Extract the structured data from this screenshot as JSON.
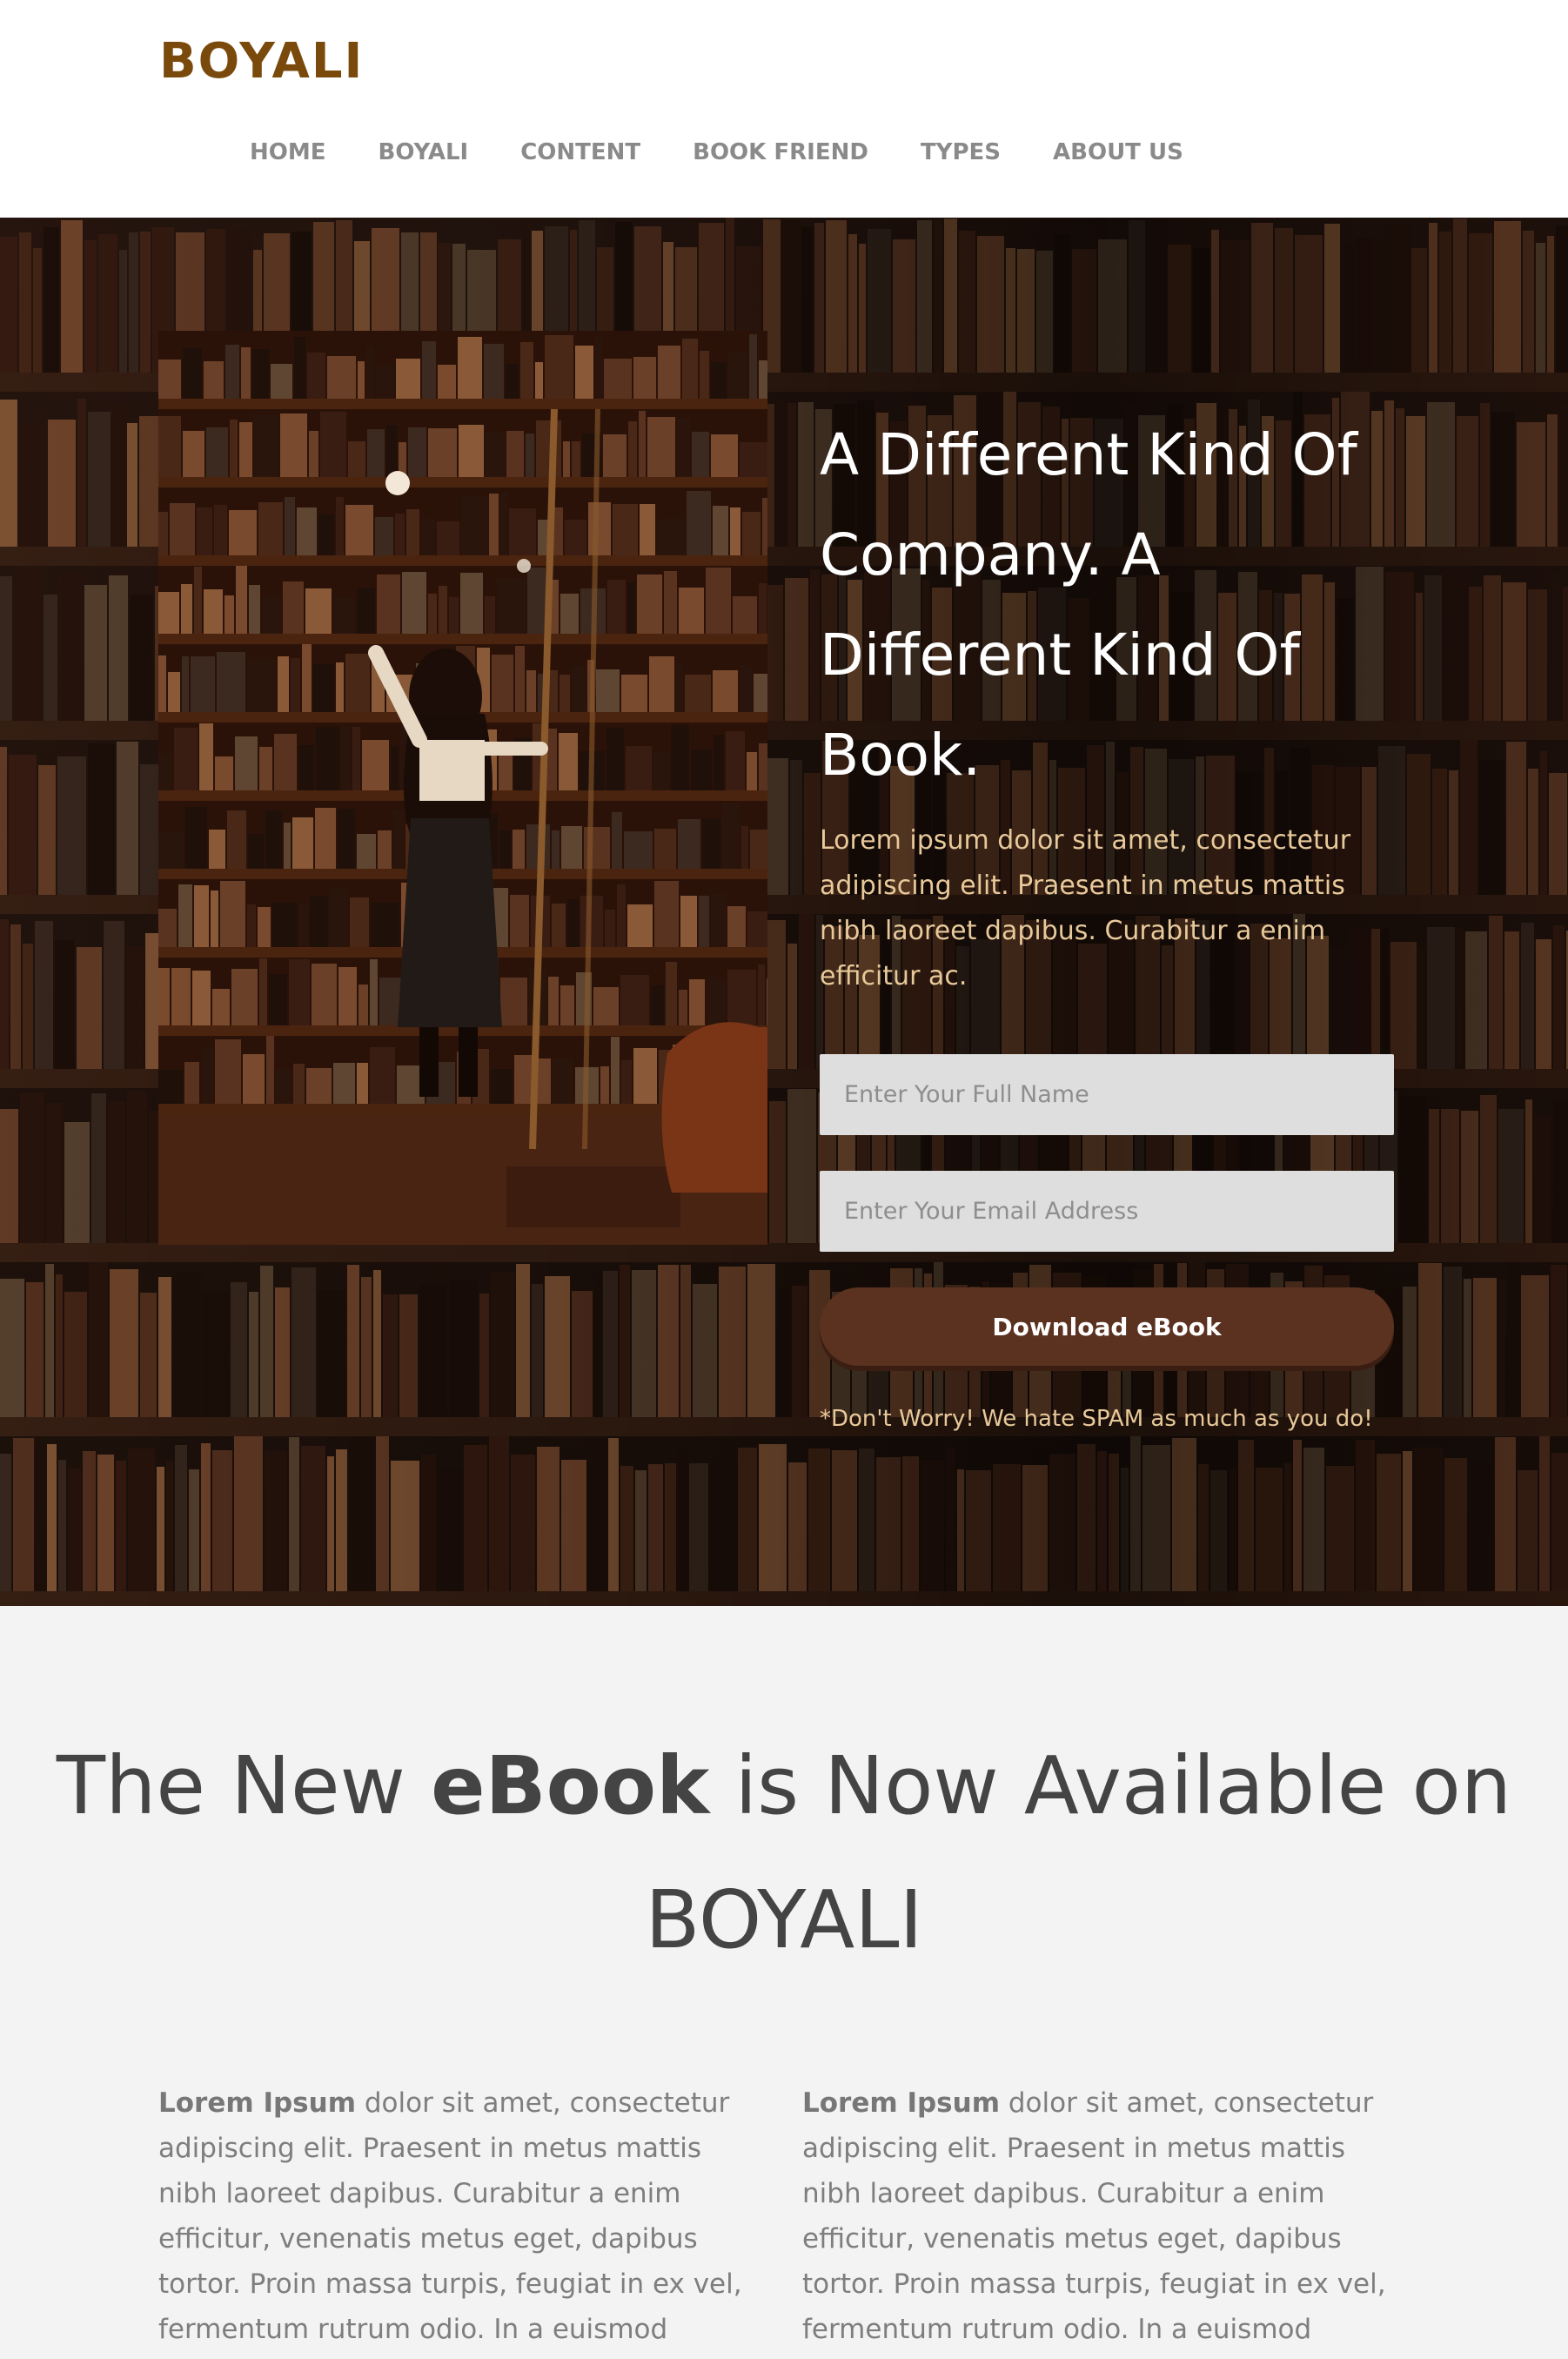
{
  "brand": {
    "logo": "BOYALI",
    "logo_color": "#7a4a0c"
  },
  "nav": {
    "items": [
      {
        "label": "HOME"
      },
      {
        "label": "BOYALI"
      },
      {
        "label": "CONTENT"
      },
      {
        "label": "BOOK FRIEND"
      },
      {
        "label": "TYPES"
      },
      {
        "label": "ABOUT US"
      }
    ]
  },
  "hero": {
    "title": "A Different Kind Of Company. A Different Kind Of Book.",
    "description": "Lorem ipsum dolor sit amet, consectetur adipiscing elit. Praesent in metus mattis nibh laoreet dapibus. Curabitur a enim efficitur ac.",
    "name_placeholder": "Enter Your Full Name",
    "email_placeholder": "Enter Your Email Address",
    "button_label": "Download eBook",
    "note": "*Don't Worry! We hate SPAM as much as you do!",
    "accent_color": "#5b3220",
    "text_accent_color": "#e8c99a"
  },
  "section": {
    "title_before": "The New ",
    "title_bold": "eBook",
    "title_after": " is Now Available on BOYALI"
  },
  "columns": [
    {
      "lead": "Lorem Ipsum",
      "text": " dolor sit amet, consectetur adipiscing elit. Praesent in metus mattis nibh laoreet dapibus. Curabitur a enim efficitur, venenatis metus eget, dapibus tortor. Proin massa turpis, feugiat in ex vel, fermentum rutrum odio. In a euismod justo, vel eleifend"
    },
    {
      "lead": "Lorem Ipsum",
      "text": " dolor sit amet, consectetur adipiscing elit. Praesent in metus mattis nibh laoreet dapibus. Curabitur a enim efficitur, venenatis metus eget, dapibus tortor. Proin massa turpis, feugiat in ex vel, fermentum rutrum odio. In a euismod justo, vel eleifend"
    }
  ]
}
